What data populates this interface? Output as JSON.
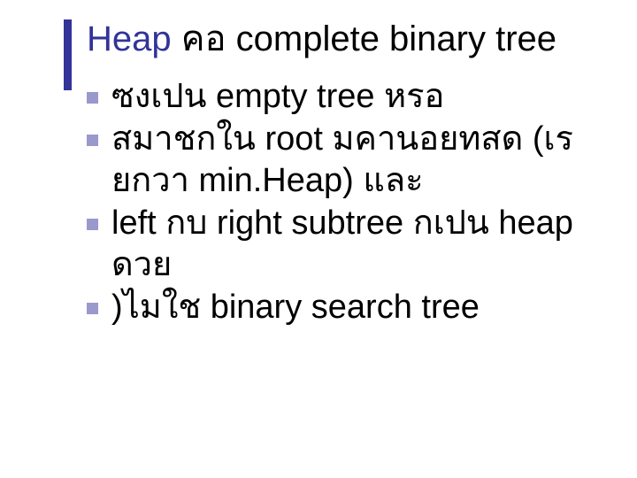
{
  "title": {
    "part1": "Heap",
    "part2": " คอ    complete binary tree"
  },
  "bullets": [
    "ซงเปน      empty tree หรอ",
    "สมาชกใน  root มคานอยทสด (เรยกวา    min.Heap) และ",
    "left กบ  right subtree กเปน heap ดวย",
    ")ไมใช    binary search tree"
  ]
}
